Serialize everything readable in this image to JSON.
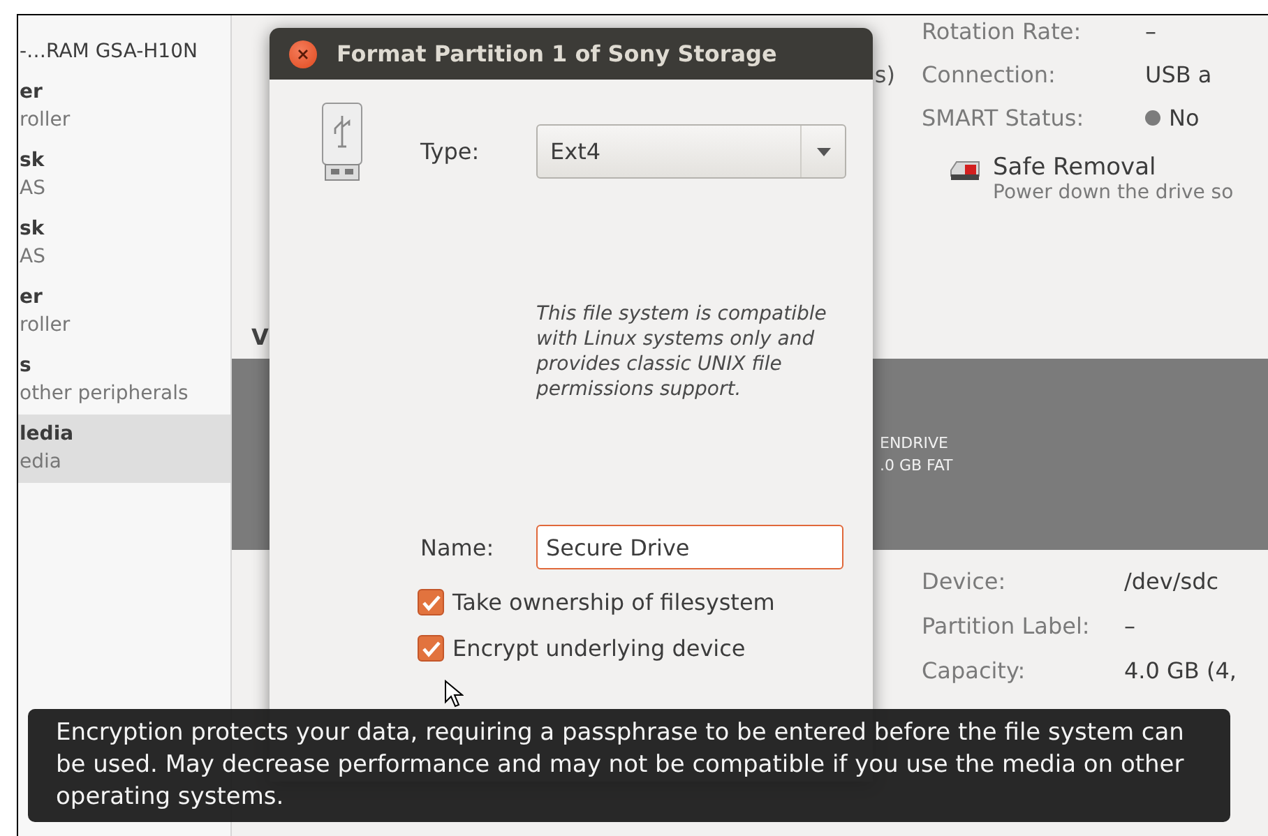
{
  "sidebar": {
    "items": [
      {
        "title": "-…RAM GSA-H10N",
        "selected": false
      },
      {
        "title": "er",
        "subtitle": "roller",
        "selected": false
      },
      {
        "title": "sk",
        "subtitle": "AS",
        "selected": false
      },
      {
        "title": "sk",
        "subtitle": "AS",
        "selected": false
      },
      {
        "title": "er",
        "subtitle": "roller",
        "selected": false
      },
      {
        "title": "s",
        "subtitle": "other peripherals",
        "selected": false
      },
      {
        "title": "ledia",
        "subtitle": "edia",
        "selected": true
      }
    ]
  },
  "drive_info": {
    "fragment": "s)",
    "rows": [
      {
        "kind": "text",
        "label": "Rotation Rate:",
        "value": "–"
      },
      {
        "kind": "text",
        "label": "Connection:",
        "value": "USB a"
      },
      {
        "kind": "status",
        "label": "SMART Status:",
        "value": "No"
      }
    ]
  },
  "safe_removal": {
    "title": "Safe Removal",
    "description": "Power down the drive so"
  },
  "section_fragment": "V",
  "volume_bar": {
    "name": "ENDRIVE",
    "detail": ".0 GB FAT"
  },
  "volume_info": [
    {
      "label": "Device:",
      "value": "/dev/sdc"
    },
    {
      "label": "Partition Label:",
      "value": "–"
    },
    {
      "label": "Capacity:",
      "value": "4.0 GB (4,"
    }
  ],
  "dialog": {
    "title": "Format Partition 1 of Sony Storage",
    "type_label": "Type:",
    "type_value": "Ext4",
    "description": "This file system is compatible with Linux systems only and provides classic UNIX file permissions support.",
    "name_label": "Name:",
    "name_value": "Secure Drive",
    "options": [
      {
        "label": "Take ownership of filesystem",
        "checked": true
      },
      {
        "label": "Encrypt underlying device",
        "checked": true
      }
    ]
  },
  "tooltip": {
    "text": "Encryption protects your data, requiring a passphrase to be entered before the file system can be used. May decrease performance and may not be compatible if you use the media on other operating systems."
  }
}
